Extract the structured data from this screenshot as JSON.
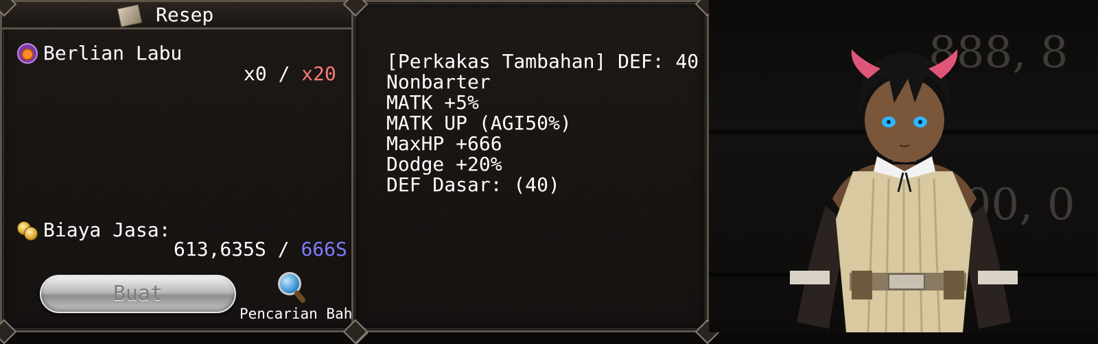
{
  "recipe_panel": {
    "title": "Resep",
    "material": {
      "name": "Berlian Labu",
      "owned": "x0",
      "separator": "/",
      "required": "x20",
      "required_color": "#ff7b7b"
    },
    "fee": {
      "label": "Biaya Jasa:",
      "current": "613,635S",
      "separator": "/",
      "cost": "666S",
      "cost_color": "#7d7dff"
    },
    "craft_button": "Buat",
    "search_label": "Pencarian Bahan"
  },
  "item_info": {
    "lines": [
      "[Perkakas Tambahan] DEF: 40",
      "Nonbarter",
      "MATK +5%",
      "MATK UP (AGI50%)",
      "MaxHP +666",
      "Dodge +20%",
      "DEF Dasar: (40)"
    ]
  },
  "preview": {
    "background_numbers": [
      "888, 8",
      "200, 0"
    ]
  },
  "icons": [
    "recipe-book-icon",
    "pumpkin-gem-icon",
    "coins-icon",
    "magnifier-icon"
  ]
}
